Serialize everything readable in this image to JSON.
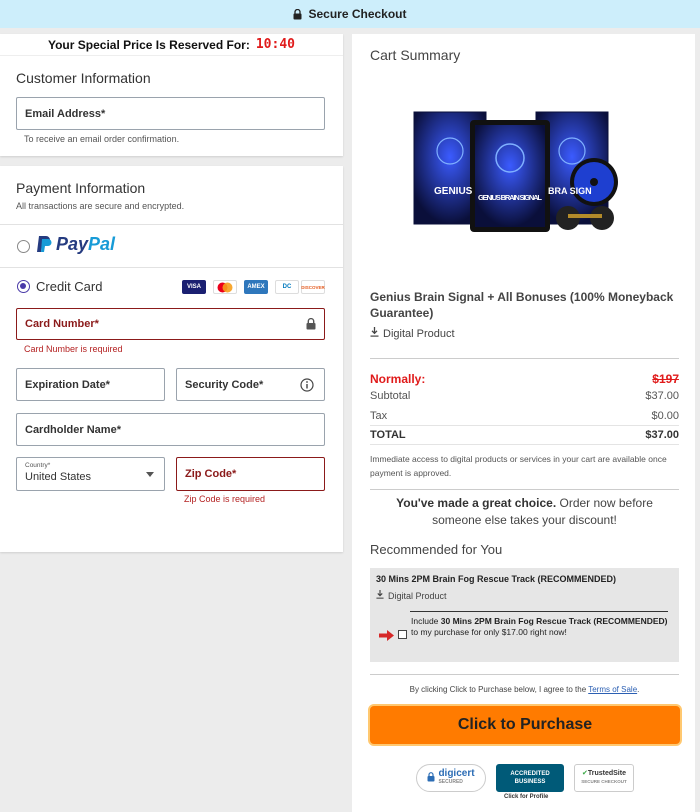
{
  "topbar": {
    "label": "Secure Checkout"
  },
  "timer": {
    "label": "Your Special Price Is Reserved For:",
    "time": "10:40"
  },
  "customer": {
    "title": "Customer Information",
    "email_label": "Email Address*",
    "email_hint": "To receive an email order confirmation."
  },
  "payment": {
    "title": "Payment Information",
    "subtitle": "All transactions are secure and encrypted.",
    "paypal_part1": "Pay",
    "paypal_part2": "Pal",
    "credit_card_label": "Credit Card",
    "cards": [
      "VISA",
      "MC",
      "AMEX",
      "DC",
      "DISCOVER"
    ],
    "card_number_label": "Card Number*",
    "card_number_error": "Card Number is required",
    "expiration_label": "Expiration Date*",
    "security_label": "Security Code*",
    "cardholder_label": "Cardholder Name*",
    "country_label": "Country*",
    "country_value": "United States",
    "zip_label": "Zip Code*",
    "zip_error": "Zip Code is required"
  },
  "cart": {
    "title": "Cart Summary",
    "image_texts": [
      "GENIUS",
      "GENIUS BRAIN SIGNAL",
      "BRA SIGN"
    ],
    "product_name": "Genius Brain Signal + All Bonuses (100% Moneyback Guarantee)",
    "product_type": "Digital Product",
    "normally_label": "Normally:",
    "normally_value": "$197",
    "subtotal_label": "Subtotal",
    "subtotal_value": "$37.00",
    "tax_label": "Tax",
    "tax_value": "$0.00",
    "total_label": "TOTAL",
    "total_value": "$37.00",
    "note": "Immediate access to digital products or services in your cart are available once payment is approved.",
    "great_bold": "You've made a great choice.",
    "great_rest": " Order now before someone else takes your discount!"
  },
  "recommend": {
    "title": "Recommended for You",
    "item_title": "30 Mins 2PM Brain Fog Rescue Track (RECOMMENDED)",
    "item_type": "Digital Product",
    "include_pre": "Include ",
    "include_bold": "30 Mins 2PM Brain Fog Rescue Track (RECOMMENDED)",
    "include_post": " to my purchase for only $17.00 right now!"
  },
  "purchase": {
    "agree_text": "By clicking Click to Purchase below, I agree to the ",
    "terms_link": "Terms of Sale",
    "agree_end": ".",
    "button_label": "Click to Purchase"
  },
  "badges": {
    "digicert": "digicert",
    "digicert_sub": "SECURED",
    "bbb": "ACCREDITED BUSINESS",
    "bbb_sub": "Click for Profile",
    "trusted": "TrustedSite",
    "trusted_sub": "SECURE CHECKOUT"
  },
  "colors": {
    "accent": "#4a3aa8",
    "error": "#b42222",
    "cta": "#ff7b00",
    "topbar": "#cdeefb"
  }
}
